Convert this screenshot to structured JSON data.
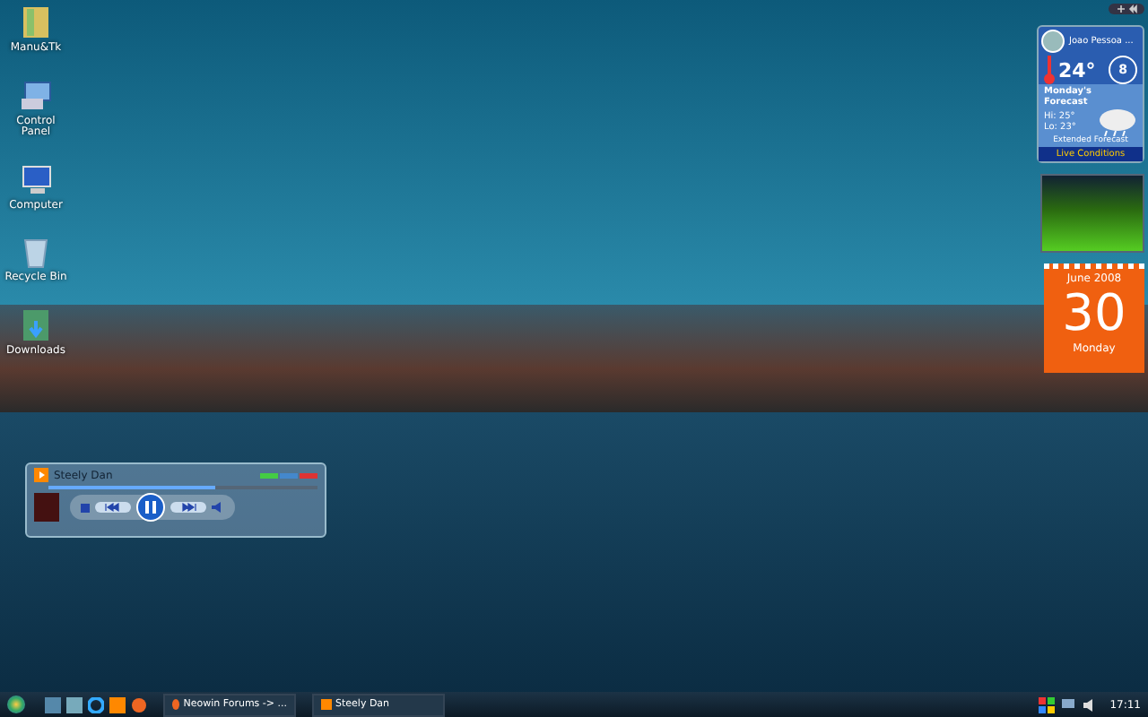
{
  "desktop_icons": [
    {
      "label": "Manu&Tk",
      "kind": "folder"
    },
    {
      "label": "Control Panel",
      "kind": "control"
    },
    {
      "label": "Computer",
      "kind": "computer"
    },
    {
      "label": "Recycle Bin",
      "kind": "bin"
    },
    {
      "label": "Downloads",
      "kind": "download"
    }
  ],
  "weather": {
    "city": "Joao Pessoa ...",
    "temp": "24°",
    "wind": "8",
    "forecast_title": "Monday's Forecast",
    "hi": "Hi: 25°",
    "lo": "Lo: 23°",
    "extended": "Extended Forecast",
    "footer": "Live Conditions"
  },
  "calendar": {
    "month": "June 2008",
    "day": "30",
    "weekday": "Monday"
  },
  "media_player": {
    "title": "Steely Dan",
    "level": 0.62
  },
  "taskbar": {
    "windows": [
      {
        "label": "Neowin Forums -> ...",
        "kind": "browser"
      },
      {
        "label": "Steely Dan",
        "kind": "media"
      }
    ],
    "clock": "17:11"
  }
}
